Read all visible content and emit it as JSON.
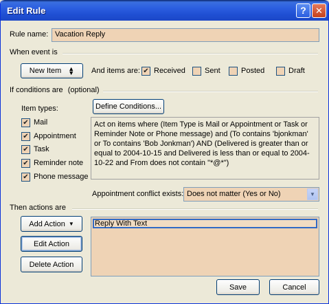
{
  "window": {
    "title": "Edit Rule",
    "help_label": "?",
    "close_label": "✕"
  },
  "rule_name": {
    "label": "Rule name:",
    "value": "Vacation Reply"
  },
  "when_event": {
    "heading": "When event is",
    "event_value": "New Item",
    "items_are_label": "And items are:",
    "checks": [
      {
        "label": "Received",
        "checked": true
      },
      {
        "label": "Sent",
        "checked": false
      },
      {
        "label": "Posted",
        "checked": false
      },
      {
        "label": "Draft",
        "checked": false
      }
    ]
  },
  "conditions": {
    "heading": "If conditions are",
    "optional": "(optional)",
    "item_types_label": "Item types:",
    "define_button": "Define Conditions...",
    "types": [
      {
        "label": "Mail",
        "checked": true
      },
      {
        "label": "Appointment",
        "checked": true
      },
      {
        "label": "Task",
        "checked": true
      },
      {
        "label": "Reminder note",
        "checked": true
      },
      {
        "label": "Phone message",
        "checked": true
      }
    ],
    "description": "Act on items where (Item Type is Mail or Appointment or Task or Reminder Note or Phone message) and (To  contains 'bjonkman' or To  contains 'Bob Jonkman') AND (Delivered is greater than or equal to 2004-10-15 and Delivered is less than or equal to 2004-10-22 and From  does not contain \"*@*\")",
    "conflict_label": "Appointment conflict exists:",
    "conflict_value": "Does not matter (Yes or No)"
  },
  "actions": {
    "heading": "Then actions are",
    "add_button": "Add Action",
    "edit_button": "Edit Action",
    "delete_button": "Delete Action",
    "list": [
      "Reply With Text"
    ]
  },
  "footer": {
    "save": "Save",
    "cancel": "Cancel"
  }
}
